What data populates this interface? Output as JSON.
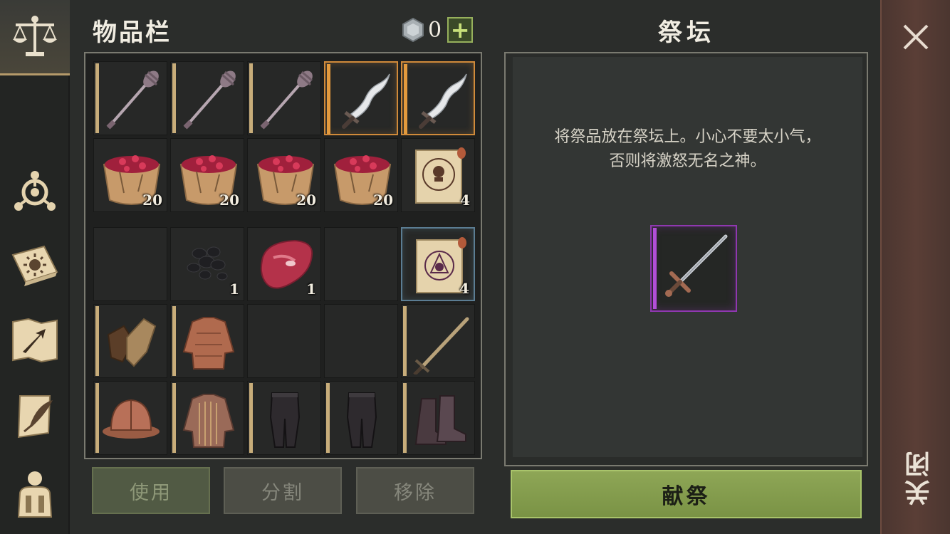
{
  "sidebar": {
    "tabs": [
      {
        "icon": "scales-icon",
        "active": true
      },
      {
        "icon": "crafting-icon",
        "active": false
      },
      {
        "icon": "sun-book-icon",
        "active": false
      },
      {
        "icon": "map-icon",
        "active": false
      },
      {
        "icon": "scroll-quill-icon",
        "active": false
      },
      {
        "icon": "character-icon",
        "active": false
      }
    ]
  },
  "inventory": {
    "title": "物品栏",
    "currency": {
      "value": "0",
      "icon": "silver-coin-icon",
      "add_label": "+"
    },
    "slots": [
      {
        "item": "mace",
        "count": "",
        "rarity": "common"
      },
      {
        "item": "mace",
        "count": "",
        "rarity": "common"
      },
      {
        "item": "mace",
        "count": "",
        "rarity": "common"
      },
      {
        "item": "wavy-dagger",
        "count": "",
        "rarity": "rare"
      },
      {
        "item": "wavy-dagger",
        "count": "",
        "rarity": "rare"
      },
      {
        "item": "berry-bowl",
        "count": "20",
        "rarity": "none"
      },
      {
        "item": "berry-bowl",
        "count": "20",
        "rarity": "none"
      },
      {
        "item": "berry-bowl",
        "count": "20",
        "rarity": "none"
      },
      {
        "item": "berry-bowl",
        "count": "20",
        "rarity": "none"
      },
      {
        "item": "skull-scroll",
        "count": "4",
        "rarity": "none"
      },
      {
        "item": "",
        "count": "",
        "rarity": "none"
      },
      {
        "item": "coal",
        "count": "1",
        "rarity": "none"
      },
      {
        "item": "raw-meat",
        "count": "1",
        "rarity": "none"
      },
      {
        "item": "",
        "count": "",
        "rarity": "none"
      },
      {
        "item": "ritual-scroll",
        "count": "4",
        "rarity": "uncommon"
      },
      {
        "item": "leather-gloves",
        "count": "",
        "rarity": "common"
      },
      {
        "item": "padded-jacket",
        "count": "",
        "rarity": "common"
      },
      {
        "item": "",
        "count": "",
        "rarity": "none"
      },
      {
        "item": "",
        "count": "",
        "rarity": "none"
      },
      {
        "item": "longsword",
        "count": "",
        "rarity": "common"
      },
      {
        "item": "kettle-helmet",
        "count": "",
        "rarity": "common"
      },
      {
        "item": "chain-shirt",
        "count": "",
        "rarity": "common"
      },
      {
        "item": "trousers",
        "count": "",
        "rarity": "common"
      },
      {
        "item": "trousers",
        "count": "",
        "rarity": "common"
      },
      {
        "item": "boots",
        "count": "",
        "rarity": "common"
      }
    ],
    "buttons": {
      "use": "使用",
      "split": "分割",
      "remove": "移除"
    }
  },
  "altar": {
    "title": "祭坛",
    "description_line1": "将祭品放在祭坛上。小心不要太小气，",
    "description_line2": "否则将激怒无名之神。",
    "offering_slot": {
      "item": "steel-sword",
      "rarity": "epic"
    },
    "offer_button": "献祭"
  },
  "close": {
    "label": "关闭",
    "icon": "close-icon"
  },
  "colors": {
    "common_bar": "#c8ad7a",
    "rare_border": "#d08a3a",
    "uncommon_border": "#5b7d93",
    "epic_border": "#8f38b0",
    "accent_green": "#8ea656"
  }
}
